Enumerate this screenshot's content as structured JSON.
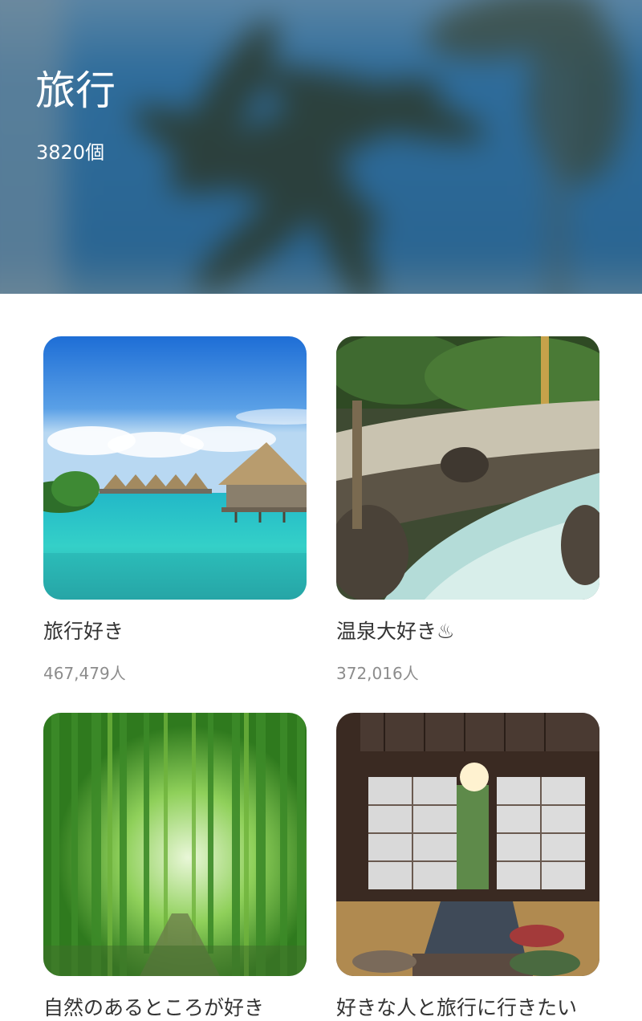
{
  "header": {
    "title": "旅行",
    "count": "3820個"
  },
  "cards": [
    {
      "title": "旅行好き",
      "members": "467,479人",
      "image": "tropical-overwater-bungalows-image"
    },
    {
      "title": "温泉大好き♨",
      "members": "372,016人",
      "image": "outdoor-hot-spring-image"
    },
    {
      "title": "自然のあるところが好き",
      "members": "",
      "image": "bamboo-forest-image"
    },
    {
      "title": "好きな人と旅行に行きたい",
      "members": "",
      "image": "japanese-ryokan-room-image"
    }
  ]
}
